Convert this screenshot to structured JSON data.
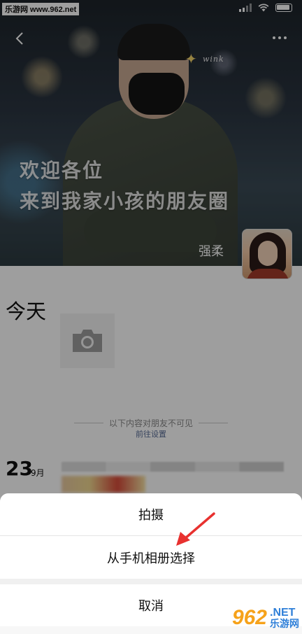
{
  "watermark_top": "乐游网 www.962.net",
  "cover": {
    "headline_line1": "欢迎各位",
    "headline_line2": "来到我家小孩的朋友圈",
    "sticker_text": "wink",
    "username": "强柔"
  },
  "feed": {
    "today_label": "今天",
    "private_notice": "以下内容对朋友不可见",
    "goto_settings": "前往设置",
    "post_date_day": "23",
    "post_date_month": "9月"
  },
  "action_sheet": {
    "shoot_label": "拍摄",
    "album_label": "从手机相册选择",
    "cancel_label": "取消"
  },
  "watermark_bottom": {
    "brand_number": "962",
    "brand_suffix": ".NET",
    "brand_name": "乐游网"
  },
  "colors": {
    "link": "#576b95",
    "arrow": "#e8312f",
    "brand_orange": "#f6a21a",
    "brand_blue": "#2f7fd8"
  },
  "icons": [
    "back-arrow-icon",
    "more-dots-icon",
    "camera-icon",
    "signal-icon",
    "wifi-icon",
    "battery-icon"
  ]
}
